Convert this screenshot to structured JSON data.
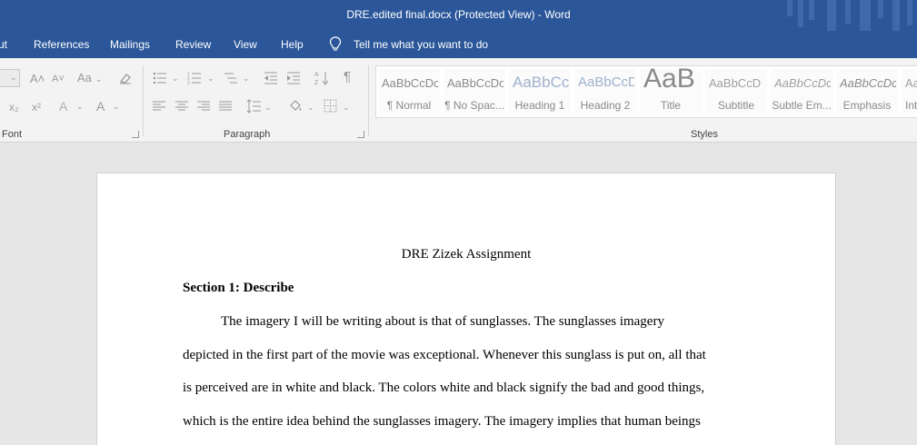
{
  "window": {
    "title": "DRE.edited final.docx (Protected View)  -  Word"
  },
  "menu": {
    "tabs": [
      "ut",
      "References",
      "Mailings",
      "Review",
      "View",
      "Help"
    ],
    "tell_me": "Tell me what you want to do"
  },
  "ribbon": {
    "font_group_label": "Font",
    "paragraph_group_label": "Paragraph",
    "styles_group_label": "Styles",
    "font_icons": {
      "grow": "A˄",
      "shrink": "A˅",
      "change_case": "Aa",
      "subscript": "x₂",
      "superscript": "x²",
      "text_effects": "A",
      "font_color": "A"
    },
    "styles": [
      {
        "sample": "AaBbCcDc",
        "name": "¶ Normal"
      },
      {
        "sample": "AaBbCcDc",
        "name": "¶ No Spac..."
      },
      {
        "sample": "AaBbCc",
        "name": "Heading 1"
      },
      {
        "sample": "AaBbCcD",
        "name": "Heading 2"
      },
      {
        "sample": "AaB",
        "name": "Title"
      },
      {
        "sample": "AaBbCcD",
        "name": "Subtitle"
      },
      {
        "sample": "AaBbCcDc",
        "name": "Subtle Em..."
      },
      {
        "sample": "AaBbCcDc",
        "name": "Emphasis"
      },
      {
        "sample": "Aa",
        "name": "Int"
      }
    ]
  },
  "document": {
    "title": "DRE Zizek Assignment",
    "section_heading": "Section 1: Describe",
    "lines": [
      "The imagery I will be writing about is that of sunglasses.  The sunglasses imagery",
      "depicted in the first part of the movie was exceptional. Whenever this sunglass is put on, all that",
      "is perceived are in white and black.  The colors white and black signify the bad and good things,",
      "which is the entire idea behind the sunglasses imagery. The imagery implies that human beings"
    ]
  }
}
